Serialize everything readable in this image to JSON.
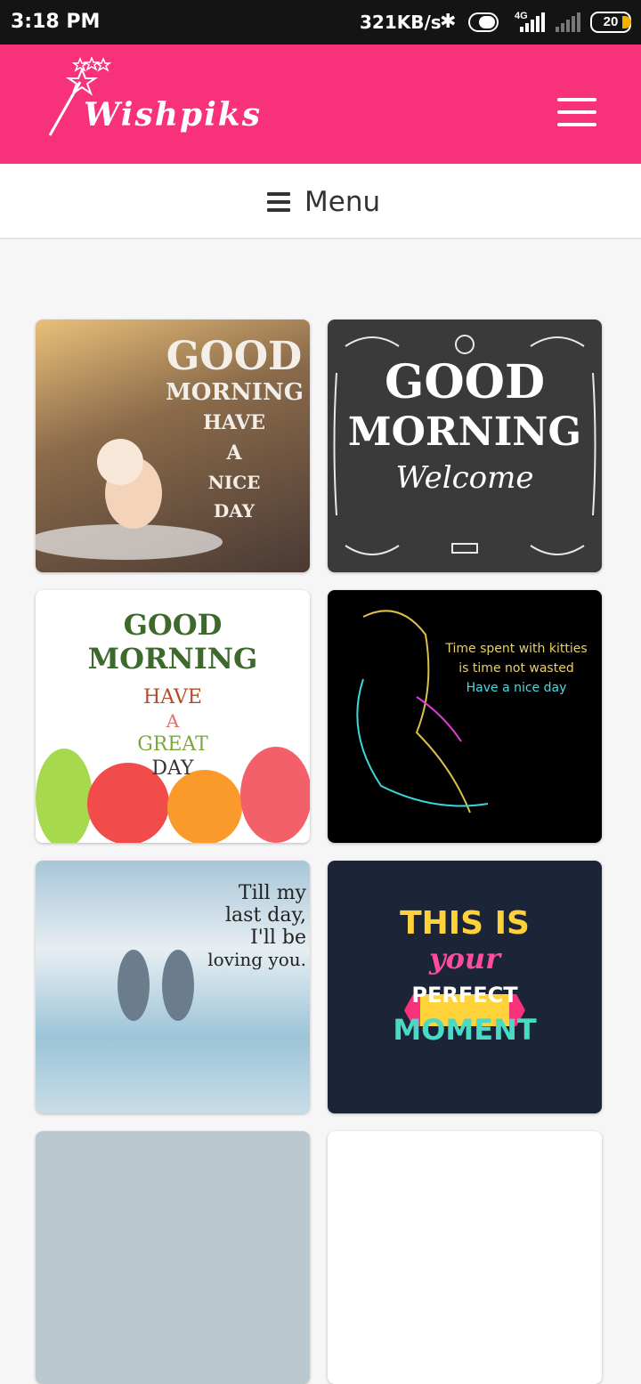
{
  "status_bar": {
    "time": "3:18 PM",
    "network_speed": "321KB/s",
    "network_type": "4G",
    "battery_level": "20",
    "icons": [
      "bluetooth-icon",
      "toggle-icon",
      "signal-icon",
      "battery-icon"
    ]
  },
  "header": {
    "logo_text": "Wishpiks",
    "menu_icon": "hamburger-icon",
    "background_color": "#f7317a"
  },
  "menu_bar": {
    "label": "Menu",
    "icon": "bars-icon"
  },
  "gallery": {
    "tiles": [
      {
        "lines": [
          "GOOD",
          "MORNING",
          "HAVE",
          "A",
          "NICE",
          "DAY"
        ]
      },
      {
        "lines": [
          "GOOD",
          "MORNING",
          "Welcome"
        ]
      },
      {
        "lines": [
          "GOOD MORNING",
          "HAVE",
          "A",
          "GREAT",
          "DAY"
        ]
      },
      {
        "lines": [
          "Time spent with kitties",
          "is time not wasted",
          "Have a nice day"
        ]
      },
      {
        "lines": [
          "Till my",
          "last day,",
          "I'll be",
          "loving you."
        ]
      },
      {
        "lines": [
          "THIS IS",
          "your",
          "PERFECT",
          "MOMENT"
        ]
      }
    ]
  }
}
